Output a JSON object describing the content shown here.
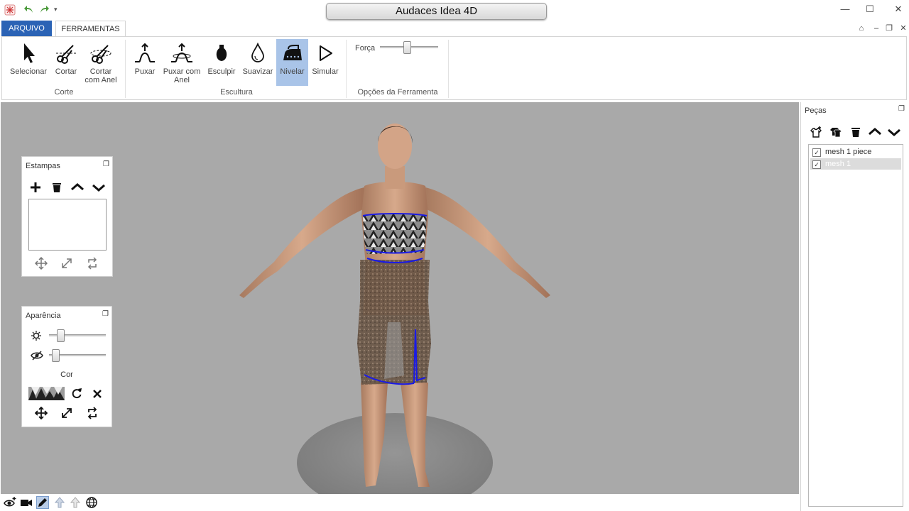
{
  "window": {
    "title": "Audaces Idea 4D",
    "min_glyph": "—",
    "max_glyph": "☐",
    "close_glyph": "✕"
  },
  "ribbon": {
    "tabs": [
      {
        "label": "ARQUIVO"
      },
      {
        "label": "FERRAMENTAS"
      }
    ],
    "groups": {
      "corte": {
        "label": "Corte",
        "tools": [
          {
            "label": "Selecionar",
            "icon": "cursor-arrow-icon"
          },
          {
            "label": "Cortar",
            "icon": "scissors-icon"
          },
          {
            "label": "Cortar com Anel",
            "icon": "scissors-ring-icon"
          }
        ]
      },
      "escultura": {
        "label": "Escultura",
        "tools": [
          {
            "label": "Puxar",
            "icon": "pull-icon"
          },
          {
            "label": "Puxar com Anel",
            "icon": "pull-ring-icon"
          },
          {
            "label": "Esculpir",
            "icon": "sculpt-icon"
          },
          {
            "label": "Suavizar",
            "icon": "drop-icon"
          },
          {
            "label": "Nivelar",
            "icon": "iron-icon",
            "active": true
          },
          {
            "label": "Simular",
            "icon": "play-icon"
          }
        ]
      },
      "opcoes": {
        "label": "Opções da Ferramenta",
        "forca_label": "Força",
        "forca_value": 0.45
      }
    },
    "active_tool_color": "#a9c4e8",
    "file_tab_color": "#2b63b5"
  },
  "estampas": {
    "title": "Estampas",
    "icons": [
      "add-icon",
      "trash-icon",
      "chevron-up-icon",
      "chevron-down-icon",
      "move-icon",
      "resize-icon",
      "rotate-icon"
    ]
  },
  "aparencia": {
    "title": "Aparência",
    "brightness_value": 0.15,
    "transparency_value": 0.05,
    "cor_label": "Cor",
    "icons": [
      "brightness-icon",
      "visibility-icon",
      "refresh-icon",
      "close-icon",
      "move-icon",
      "resize-icon",
      "rotate-icon"
    ]
  },
  "pecas": {
    "title": "Peças",
    "items": [
      {
        "label": "mesh 1 piece",
        "checked": true,
        "selected": false
      },
      {
        "label": "mesh 1",
        "checked": true,
        "selected": true
      }
    ],
    "icons": [
      "add-shirt-icon",
      "group-shirts-icon",
      "trash-icon",
      "chevron-up-icon",
      "chevron-down-icon"
    ]
  },
  "bottom_toolbar": {
    "icons": [
      "add-view-icon",
      "camera-icon",
      "pencil-icon",
      "arrow-up-icon",
      "arrow-up-alt-icon",
      "globe-icon"
    ],
    "active_icon": "pencil-icon"
  },
  "viewport": {
    "background": "#a9a9a9",
    "floor_color": "#8a8a8a",
    "outline_color": "#1a1ae6"
  }
}
